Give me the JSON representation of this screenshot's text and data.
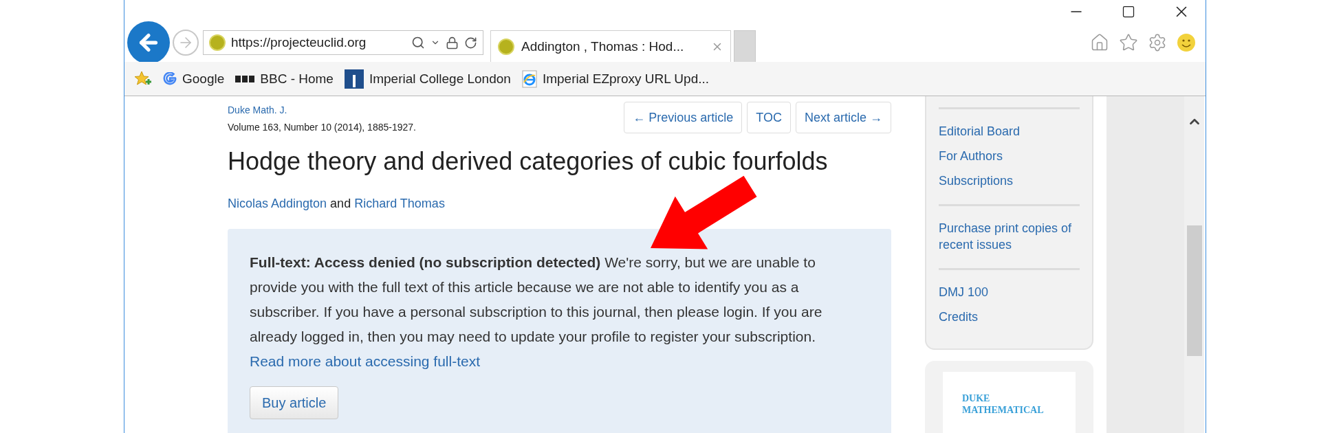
{
  "browser": {
    "url": "https://projecteuclid.org",
    "tabs": [
      {
        "title": "Addington , Thomas : Hod...",
        "selected": true
      }
    ],
    "favorites": [
      {
        "kind": "add"
      },
      {
        "label": "Google",
        "kind": "google"
      },
      {
        "label": "BBC - Home",
        "kind": "bbc"
      },
      {
        "label": "Imperial College London",
        "kind": "imperial"
      },
      {
        "label": "Imperial EZproxy URL Upd...",
        "kind": "ie"
      }
    ]
  },
  "article": {
    "journal": "Duke Math. J.",
    "citation": "Volume 163, Number 10 (2014), 1885-1927.",
    "nav": [
      "← Previous article",
      "TOC",
      "Next article →"
    ],
    "title": "Hodge theory and derived categories of cubic fourfolds",
    "authors": [
      "Nicolas Addington",
      "Richard Thomas"
    ],
    "author_separator": "and",
    "access": {
      "message": "**Full-text: Access denied (no subscription detected)** We're sorry, but we are unable to provide you with the full text of this article because we are not able to identify you as a subscriber. If you have a personal subscription to this journal, then please login. If you are already logged in, then you may need to update your profile to register your subscription.",
      "link": "Read more about accessing full-text",
      "button": "Buy article"
    }
  },
  "sidebar": {
    "groups": [
      [
        "Editorial Board",
        "For Authors",
        "Subscriptions"
      ],
      [
        "Purchase print copies of recent issues"
      ],
      [
        "DMJ 100",
        "Credits"
      ]
    ],
    "cover": [
      "DUKE",
      "MATHEMATICAL"
    ]
  }
}
